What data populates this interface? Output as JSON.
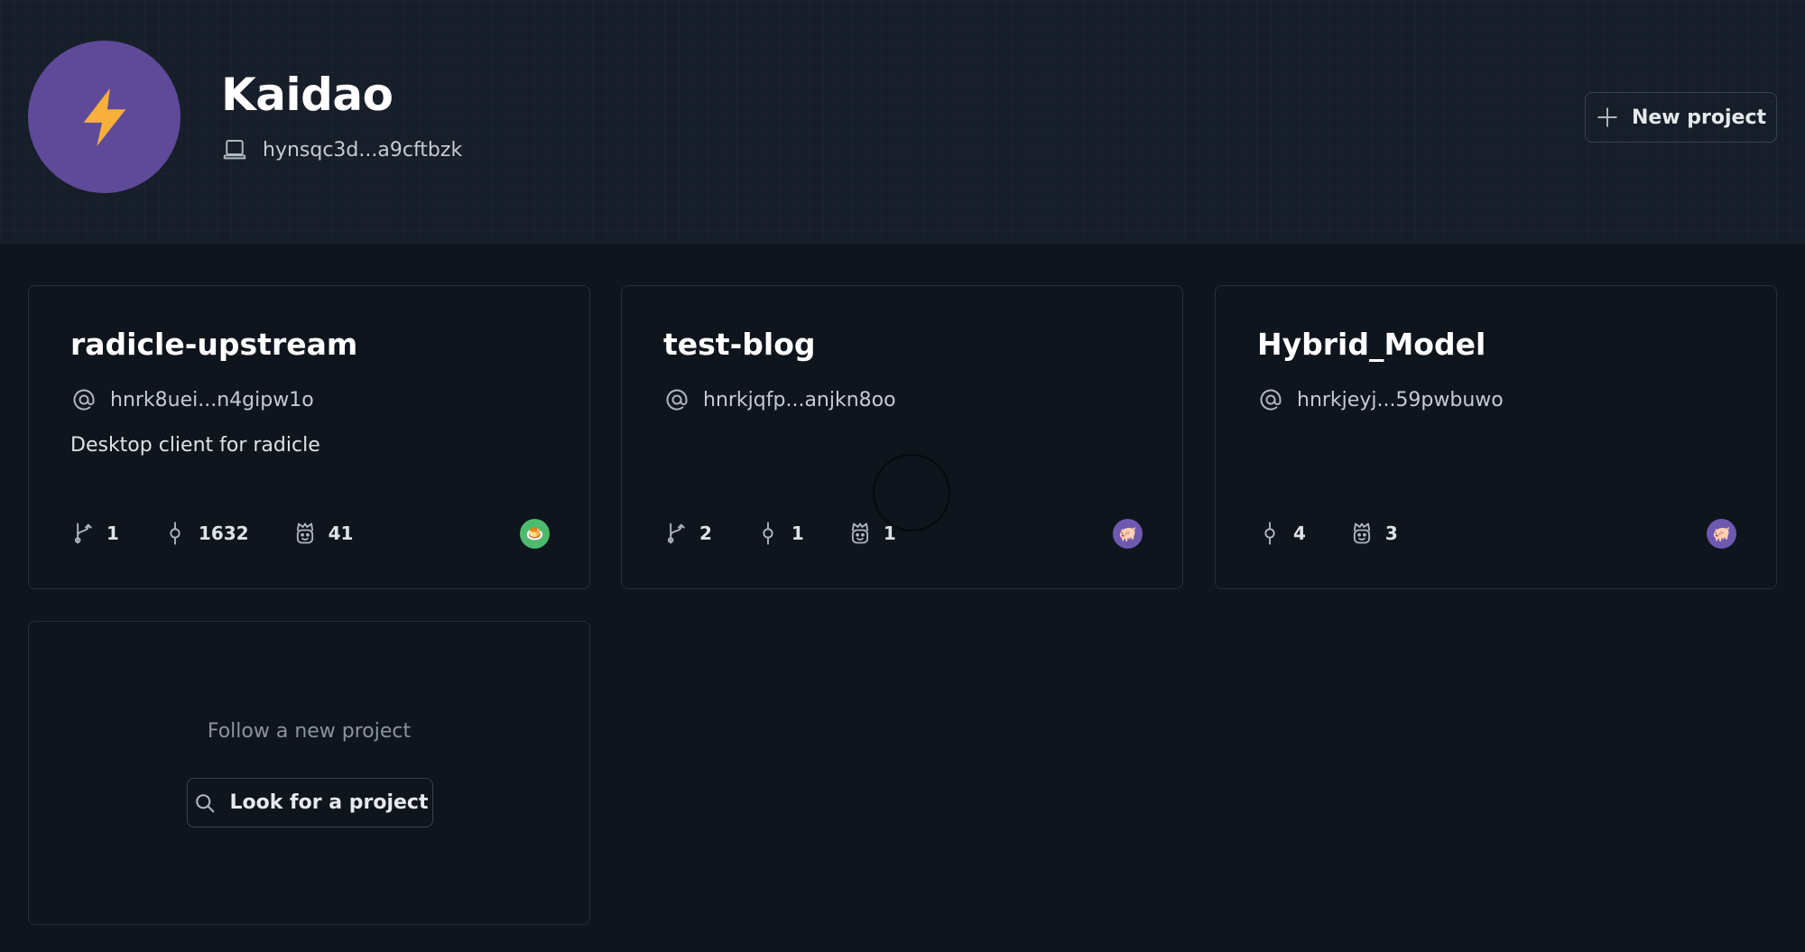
{
  "profile": {
    "name": "Kaidao",
    "avatar_emoji": "⚡",
    "avatar_color": "#5e4a99",
    "device_icon": "laptop-icon",
    "device_id": "hynsqc3d...a9cftbzk"
  },
  "header": {
    "new_project_label": "New project"
  },
  "projects": [
    {
      "name": "radicle-upstream",
      "urn": "hnrk8uei...n4gipw1o",
      "description": "Desktop client for radicle",
      "patches": "1",
      "commits": "1632",
      "contributors": "41",
      "peer_avatar_emoji": "🍮",
      "peer_avatar_color": "#4cbb6e"
    },
    {
      "name": "test-blog",
      "urn": "hnrkjqfp...anjkn8oo",
      "description": "",
      "patches": "2",
      "commits": "1",
      "contributors": "1",
      "peer_avatar_emoji": "🐖",
      "peer_avatar_color": "#6e59b0"
    },
    {
      "name": "Hybrid_Model",
      "urn": "hnrkjeyj...59pwbuwo",
      "description": "",
      "commits": "4",
      "contributors": "3",
      "peer_avatar_emoji": "🐖",
      "peer_avatar_color": "#6e59b0"
    }
  ],
  "follow": {
    "text": "Follow a new project",
    "button_label": "Look for a project"
  },
  "colors": {
    "background": "#0e151d",
    "header_background": "#161e29",
    "border": "#262f3a",
    "text_primary": "#ffffff",
    "text_muted": "#8a94a0"
  }
}
